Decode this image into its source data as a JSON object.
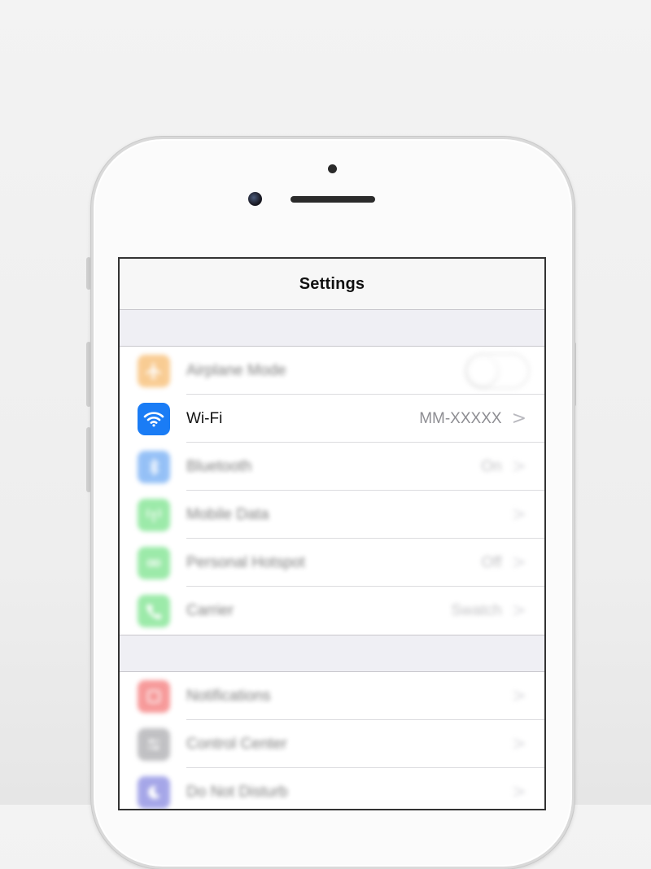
{
  "screen": {
    "title": "Settings"
  },
  "rows_group1": [
    {
      "name": "airplane",
      "label": "Airplane Mode",
      "value": "",
      "icon": "airplane-icon",
      "color": "#f4a33c"
    },
    {
      "name": "wifi",
      "label": "Wi-Fi",
      "value": "MM-XXXXX",
      "icon": "wifi-icon",
      "color": "#1a7cf5"
    },
    {
      "name": "bluetooth",
      "label": "Bluetooth",
      "value": "On",
      "icon": "bluetooth-icon",
      "color": "#3f8ef0"
    },
    {
      "name": "mobile-data",
      "label": "Mobile Data",
      "value": "",
      "icon": "antenna-icon",
      "color": "#4cd964"
    },
    {
      "name": "hotspot",
      "label": "Personal Hotspot",
      "value": "Off",
      "icon": "hotspot-icon",
      "color": "#4cd964"
    },
    {
      "name": "carrier",
      "label": "Carrier",
      "value": "Swatch",
      "icon": "phone-icon",
      "color": "#4cd964"
    }
  ],
  "rows_group2": [
    {
      "name": "notifications",
      "label": "Notifications",
      "value": "",
      "icon": "notifications-icon",
      "color": "#f04848"
    },
    {
      "name": "control-center",
      "label": "Control Center",
      "value": "",
      "icon": "control-center-icon",
      "color": "#8e8e93"
    },
    {
      "name": "do-not-disturb",
      "label": "Do Not Disturb",
      "value": "",
      "icon": "moon-icon",
      "color": "#5d5fd6"
    }
  ],
  "chevron": ">"
}
